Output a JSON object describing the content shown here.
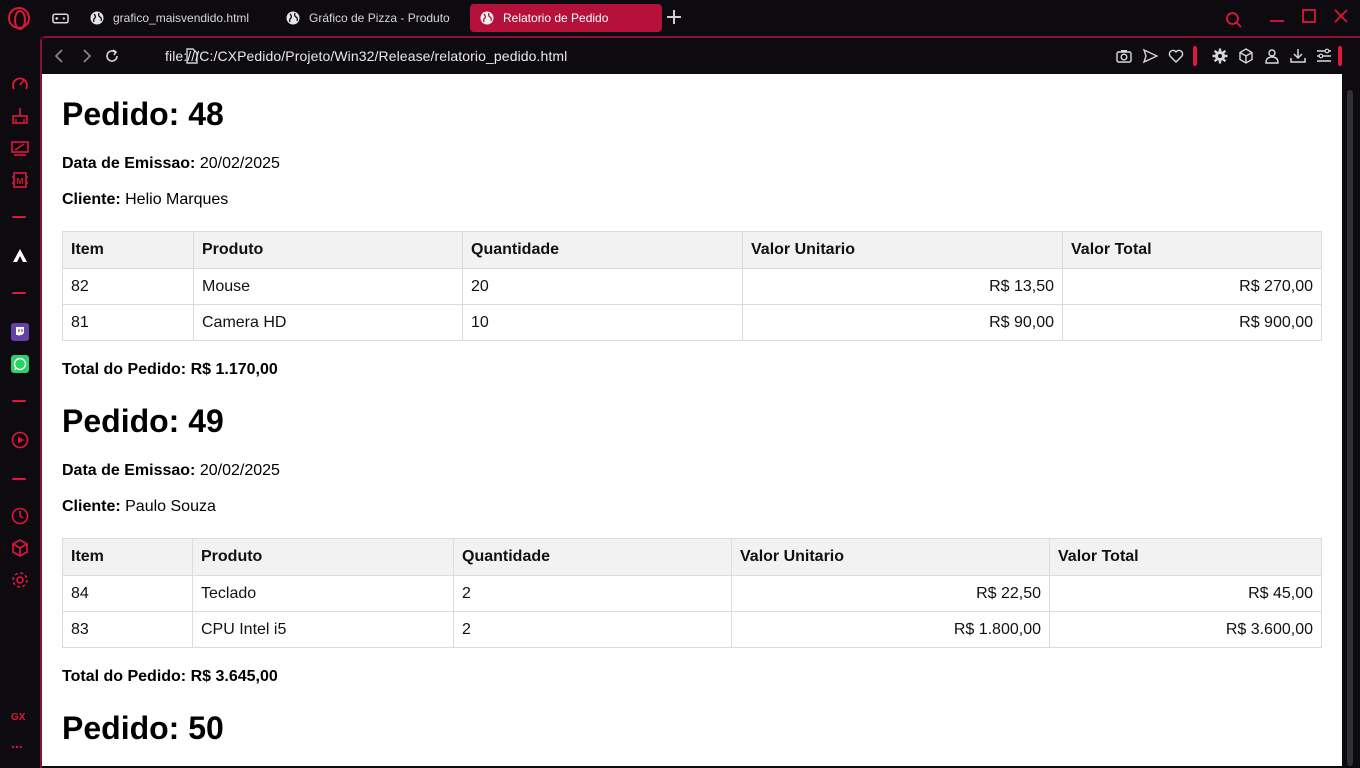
{
  "tabs": [
    {
      "label": "grafico_maisvendido.html"
    },
    {
      "label": "Gráfico de Pizza - Produto"
    },
    {
      "label": "Relatorio de Pedido"
    }
  ],
  "address": {
    "url": "file:///C:/CXPedido/Projeto/Win32/Release/relatorio_pedido.html"
  },
  "labels": {
    "pedido_prefix": "Pedido: ",
    "data_emissao": "Data de Emissao:",
    "cliente": "Cliente:",
    "total": "Total do Pedido:"
  },
  "table_headers": [
    "Item",
    "Produto",
    "Quantidade",
    "Valor Unitario",
    "Valor Total"
  ],
  "pedidos": [
    {
      "title": "Pedido: 48",
      "data_emissao": "20/02/2025",
      "cliente": "Helio Marques",
      "rows": [
        {
          "item": "82",
          "produto": "Mouse",
          "quantidade": "20",
          "valor_unitario": "R$ 13,50",
          "valor_total": "R$ 270,00"
        },
        {
          "item": "81",
          "produto": "Camera HD",
          "quantidade": "10",
          "valor_unitario": "R$ 90,00",
          "valor_total": "R$ 900,00"
        }
      ],
      "total": "R$ 1.170,00"
    },
    {
      "title": "Pedido: 49",
      "data_emissao": "20/02/2025",
      "cliente": "Paulo Souza",
      "rows": [
        {
          "item": "84",
          "produto": "Teclado",
          "quantidade": "2",
          "valor_unitario": "R$ 22,50",
          "valor_total": "R$ 45,00"
        },
        {
          "item": "83",
          "produto": "CPU Intel i5",
          "quantidade": "2",
          "valor_unitario": "R$ 1.800,00",
          "valor_total": "R$ 3.600,00"
        }
      ],
      "total": "R$ 3.645,00"
    },
    {
      "title": "Pedido: 50"
    }
  ],
  "sidebar": {
    "gx_label": "GX",
    "more_label": "..."
  },
  "colors": {
    "accent": "#e0163c",
    "active_tab": "#b5113a",
    "background": "#0d0b10",
    "table_header": "#f2f2f2"
  }
}
